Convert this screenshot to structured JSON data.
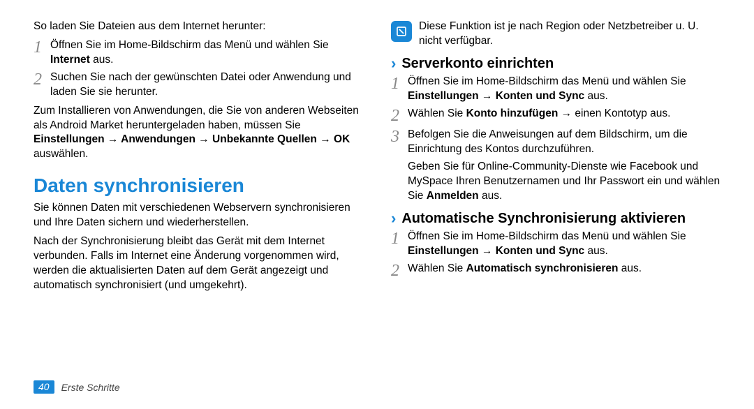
{
  "left": {
    "intro": "So laden Sie Dateien aus dem Internet herunter:",
    "step1_a": "Öffnen Sie im Home-Bildschirm das Menü und wählen Sie ",
    "step1_b": "Internet",
    "step1_c": " aus.",
    "step2": "Suchen Sie nach der gewünschten Datei oder Anwendung und laden Sie sie herunter.",
    "para2_a": "Zum Installieren von Anwendungen, die Sie von anderen Webseiten als Android Market heruntergeladen haben, müssen Sie ",
    "para2_b": "Einstellungen → Anwendungen → Unbekannte Quellen → OK",
    "para2_c": " auswählen.",
    "heading": "Daten synchronisieren",
    "syncP1": "Sie können Daten mit verschiedenen Webservern synchronisieren und Ihre Daten sichern und wiederherstellen.",
    "syncP2": "Nach der Synchronisierung bleibt das Gerät mit dem Internet verbunden. Falls im Internet eine Änderung vorgenommen wird, werden die aktualisierten Daten auf dem Gerät angezeigt und automatisch synchronisiert (und umgekehrt)."
  },
  "right": {
    "note": "Diese Funktion ist je nach Region oder Netzbetreiber u. U. nicht verfügbar.",
    "sub1": "Serverkonto einrichten",
    "s1_step1_a": "Öffnen Sie im Home-Bildschirm das Menü und wählen Sie ",
    "s1_step1_b": "Einstellungen → Konten und Sync",
    "s1_step1_c": " aus.",
    "s1_step2_a": "Wählen Sie ",
    "s1_step2_b": "Konto hinzufügen",
    "s1_step2_c": " → einen Kontotyp aus.",
    "s1_step3": "Befolgen Sie die Anweisungen auf dem Bildschirm, um die Einrichtung des Kontos durchzuführen.",
    "s1_tail_a": "Geben Sie für Online-Community-Dienste wie Facebook und MySpace Ihren Benutzernamen und Ihr Passwort ein und wählen Sie ",
    "s1_tail_b": "Anmelden",
    "s1_tail_c": " aus.",
    "sub2": "Automatische Synchronisierung aktivieren",
    "s2_step1_a": "Öffnen Sie im Home-Bildschirm das Menü und wählen Sie ",
    "s2_step1_b": "Einstellungen → Konten und Sync",
    "s2_step1_c": " aus.",
    "s2_step2_a": "Wählen Sie ",
    "s2_step2_b": "Automatisch synchronisieren",
    "s2_step2_c": " aus."
  },
  "footer": {
    "page": "40",
    "section": "Erste Schritte"
  },
  "nums": {
    "n1": "1",
    "n2": "2",
    "n3": "3"
  }
}
